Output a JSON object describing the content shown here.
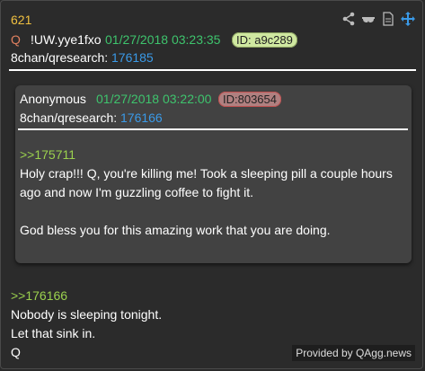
{
  "post": {
    "number": "621",
    "q_label": "Q",
    "tripcode": "!UW.yye1fxo",
    "date": "01/27/2018 03:23:35",
    "id": "ID: a9c289",
    "board": "8chan/qresearch:",
    "post_link": "176185"
  },
  "quoted": {
    "name": "Anonymous",
    "date": "01/27/2018 03:22:00",
    "id": "ID:803654",
    "board": "8chan/qresearch:",
    "post_link": "176166",
    "reply_ref": ">>175711",
    "line1": "Holy crap!!! Q, you're killing me! Took a sleeping pill a couple hours",
    "line2": "ago and now I'm guzzling coffee to fight it.",
    "line3": "God bless you for this amazing work that you are doing."
  },
  "reply": {
    "reply_ref": ">>176166",
    "line1": "Nobody is sleeping tonight.",
    "line2": "Let that sink in.",
    "line3": "Q"
  },
  "footer": "Provided by QAgg.news",
  "icons": [
    "share-icon",
    "glasses-icon",
    "document-icon",
    "move-icon"
  ]
}
